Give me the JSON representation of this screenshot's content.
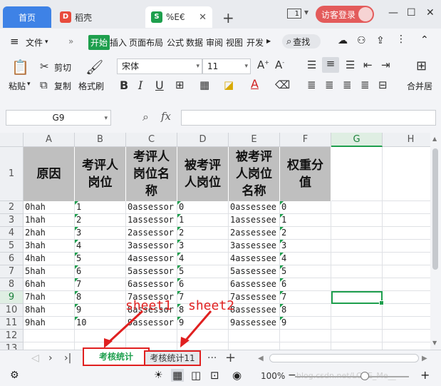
{
  "tabs": {
    "home": "首页",
    "wps": "稻壳",
    "doc": "%E€",
    "wps_icon": "D",
    "doc_icon": "S"
  },
  "window": {
    "counter": "1",
    "guest_login": "访客登录"
  },
  "menu": {
    "file": "文件",
    "items": [
      "开始",
      "插入",
      "页面布局",
      "公式",
      "数据",
      "审阅",
      "视图",
      "开发"
    ],
    "search": "查找"
  },
  "ribbon": {
    "paste": "粘贴",
    "cut": "剪切",
    "copy": "复制",
    "format_painter": "格式刷",
    "font_name": "宋体",
    "font_size": "11",
    "bold": "B",
    "italic": "I",
    "underline": "U",
    "font_color_glyph": "A",
    "merge_center": "合并居"
  },
  "formula_bar": {
    "name_box": "G9",
    "fx": "fx",
    "formula": ""
  },
  "grid": {
    "columns": [
      "A",
      "B",
      "C",
      "D",
      "E",
      "F",
      "G",
      "H"
    ],
    "rows": [
      "1",
      "2",
      "3",
      "4",
      "5",
      "6",
      "7",
      "8",
      "9",
      "10",
      "11",
      "12",
      "13"
    ],
    "headers": [
      "原因",
      "考评人岗位",
      "考评人岗位名称",
      "被考评人岗位",
      "被考评人岗位名称",
      "权重分值"
    ],
    "data": [
      [
        "0hah",
        "1",
        "0assessor",
        "0",
        "0assessee",
        "0"
      ],
      [
        "1hah",
        "2",
        "1assessor",
        "1",
        "1assessee",
        "1"
      ],
      [
        "2hah",
        "3",
        "2assessor",
        "2",
        "2assessee",
        "2"
      ],
      [
        "3hah",
        "4",
        "3assessor",
        "3",
        "3assessee",
        "3"
      ],
      [
        "4hah",
        "5",
        "4assessor",
        "4",
        "4assessee",
        "4"
      ],
      [
        "5hah",
        "6",
        "5assessor",
        "5",
        "5assessee",
        "5"
      ],
      [
        "6hah",
        "7",
        "6assessor",
        "6",
        "6assessee",
        "6"
      ],
      [
        "7hah",
        "8",
        "7assessor",
        "7",
        "7assessee",
        "7"
      ],
      [
        "8hah",
        "9",
        "8assessor",
        "8",
        "8assessee",
        "8"
      ],
      [
        "9hah",
        "10",
        "9assessor",
        "9",
        "9assessee",
        "9"
      ]
    ],
    "selected_cell": "G9"
  },
  "sheets": {
    "tab1": "考核统计",
    "tab2": "考核统计11",
    "more": "···",
    "add": "+"
  },
  "annotations": {
    "sheet1": "sheet1",
    "sheet2": "sheet2"
  },
  "status": {
    "zoom": "100%",
    "watermark": "blog.csdn.net/LOVE_Me__"
  },
  "colors": {
    "accent_green": "#1e9f4d",
    "home_tab": "#3e82e6",
    "annotation_red": "#e02020",
    "header_fill": "#bfbfbf"
  }
}
